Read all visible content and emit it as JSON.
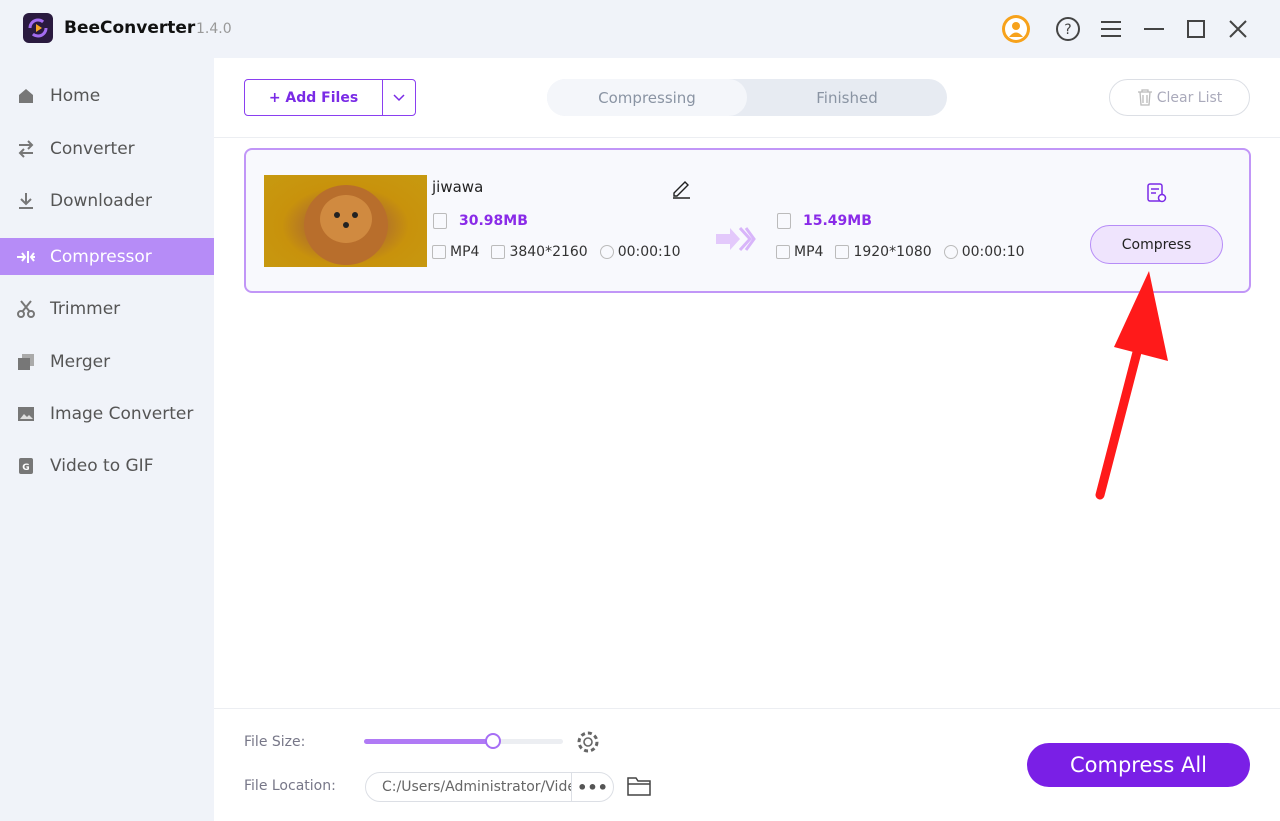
{
  "app": {
    "name": "BeeConverter",
    "version": "1.4.0"
  },
  "titlebar": {
    "icons": [
      "account-icon",
      "help-icon",
      "menu-icon",
      "minimize-icon",
      "maximize-icon",
      "close-icon"
    ]
  },
  "sidebar": {
    "items": [
      {
        "label": "Home",
        "icon": "home-icon"
      },
      {
        "label": "Converter",
        "icon": "convert-icon"
      },
      {
        "label": "Downloader",
        "icon": "download-icon"
      },
      {
        "label": "Compressor",
        "icon": "compress-icon",
        "active": true
      },
      {
        "label": "Trimmer",
        "icon": "scissors-icon"
      },
      {
        "label": "Merger",
        "icon": "merge-icon"
      },
      {
        "label": "Image Converter",
        "icon": "image-icon"
      },
      {
        "label": "Video to GIF",
        "icon": "gif-icon"
      }
    ]
  },
  "toolbar": {
    "add_files": "+ Add Files",
    "tabs": [
      "Compressing",
      "Finished"
    ],
    "clear_list": "Clear List"
  },
  "file": {
    "name": "jiwawa",
    "source": {
      "size": "30.98MB",
      "format": "MP4",
      "resolution": "3840*2160",
      "duration": "00:00:10"
    },
    "output": {
      "size": "15.49MB",
      "format": "MP4",
      "resolution": "1920*1080",
      "duration": "00:00:10"
    },
    "compress": "Compress"
  },
  "footer": {
    "file_size_label": "File Size:",
    "file_size_percent": 65,
    "file_location_label": "File Location:",
    "file_location": "C:/Users/Administrator/Videos",
    "more": "•••",
    "compress_all": "Compress All"
  },
  "colors": {
    "accent": "#7a1fe6",
    "sidebar_active": "#b68cf7",
    "annotation_arrow": "#ff1a1a"
  }
}
